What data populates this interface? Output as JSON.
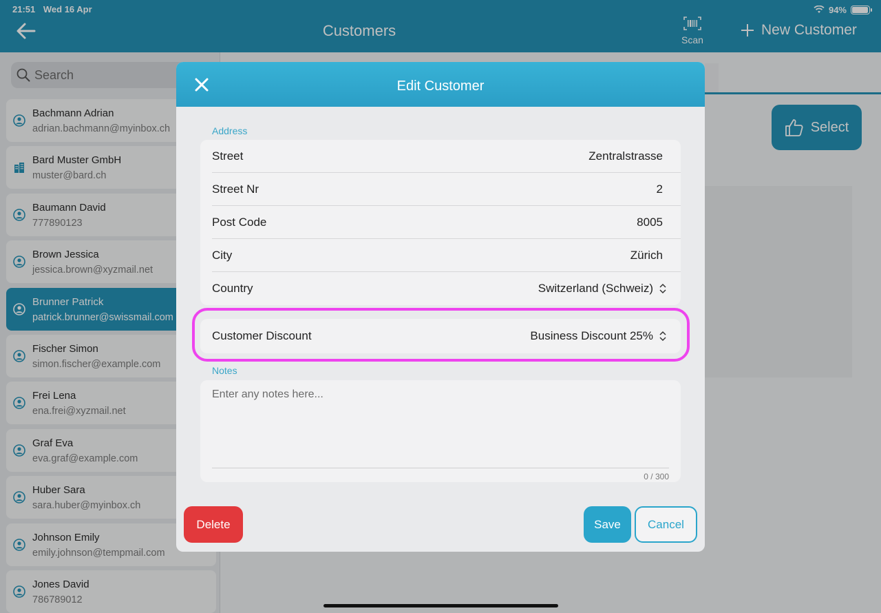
{
  "status_bar": {
    "time": "21:51",
    "date": "Wed 16 Apr",
    "battery": "94%",
    "battery_level": 0.94
  },
  "header": {
    "title": "Customers",
    "scan_label": "Scan",
    "new_customer_label": "New Customer"
  },
  "search": {
    "placeholder": "Search"
  },
  "customers": [
    {
      "name": "Bachmann Adrian",
      "sub": "adrian.bachmann@myinbox.ch",
      "icon": "person-icon"
    },
    {
      "name": "Bard Muster GmbH",
      "sub": "muster@bard.ch",
      "icon": "building-icon"
    },
    {
      "name": "Baumann David",
      "sub": "777890123",
      "icon": "person-icon"
    },
    {
      "name": "Brown Jessica",
      "sub": "jessica.brown@xyzmail.net",
      "icon": "person-icon"
    },
    {
      "name": "Brunner Patrick",
      "sub": "patrick.brunner@swissmail.com",
      "icon": "person-icon",
      "selected": true
    },
    {
      "name": "Fischer Simon",
      "sub": "simon.fischer@example.com",
      "icon": "person-icon"
    },
    {
      "name": "Frei Lena",
      "sub": "ena.frei@xyzmail.net",
      "icon": "person-icon"
    },
    {
      "name": "Graf Eva",
      "sub": "eva.graf@example.com",
      "icon": "person-icon"
    },
    {
      "name": "Huber Sara",
      "sub": "sara.huber@myinbox.ch",
      "icon": "person-icon"
    },
    {
      "name": "Johnson Emily",
      "sub": "emily.johnson@tempmail.com",
      "icon": "person-icon"
    },
    {
      "name": "Jones David",
      "sub": "786789012",
      "icon": "person-icon"
    }
  ],
  "right_panel": {
    "select_label": "Select"
  },
  "modal": {
    "title": "Edit Customer",
    "address_label": "Address",
    "fields": [
      {
        "label": "Street",
        "value": "Zentralstrasse"
      },
      {
        "label": "Street Nr",
        "value": "2"
      },
      {
        "label": "Post Code",
        "value": "8005"
      },
      {
        "label": "City",
        "value": "Zürich"
      },
      {
        "label": "Country",
        "value": "Switzerland (Schweiz)"
      }
    ],
    "discount": {
      "label": "Customer Discount",
      "value": "Business Discount 25%"
    },
    "notes_label": "Notes",
    "notes_placeholder": "Enter any notes here...",
    "notes_counter": "0 / 300",
    "delete_label": "Delete",
    "save_label": "Save",
    "cancel_label": "Cancel"
  },
  "colors": {
    "accent": "#2490b4",
    "delete": "#e2393c",
    "highlight": "#ee44ee"
  }
}
